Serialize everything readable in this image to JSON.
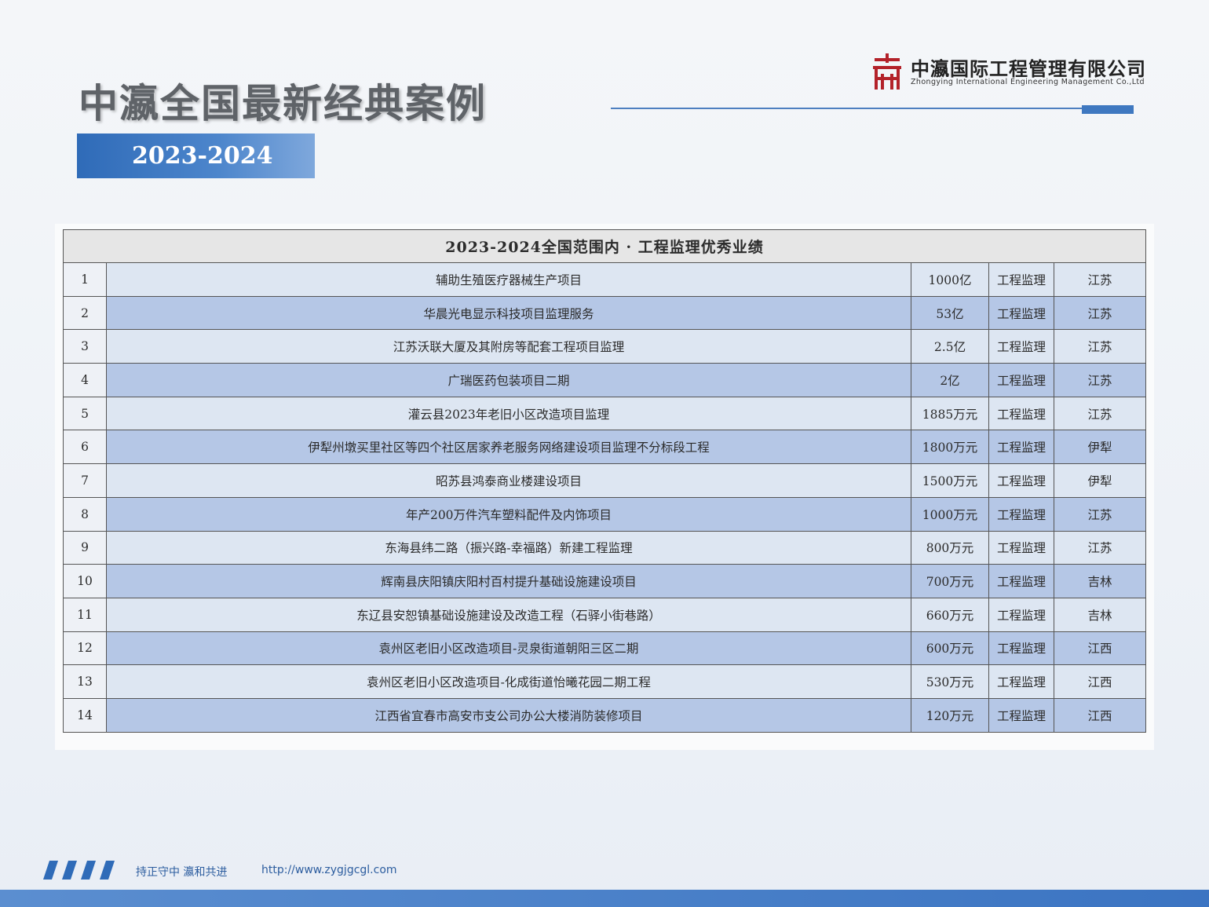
{
  "header": {
    "title": "中瀛全国最新经典案例",
    "year_badge": "2023-2024",
    "company_cn": "中瀛国际工程管理有限公司",
    "company_en": "Zhongying International Engineering Management Co.,Ltd"
  },
  "table": {
    "title": "2023-2024全国范围内 · 工程监理优秀业绩",
    "rows": [
      {
        "no": "1",
        "project": "辅助生殖医疗器械生产项目",
        "amount": "1000亿",
        "type": "工程监理",
        "region": "江苏"
      },
      {
        "no": "2",
        "project": "华晨光电显示科技项目监理服务",
        "amount": "53亿",
        "type": "工程监理",
        "region": "江苏"
      },
      {
        "no": "3",
        "project": "江苏沃联大厦及其附房等配套工程项目监理",
        "amount": "2.5亿",
        "type": "工程监理",
        "region": "江苏"
      },
      {
        "no": "4",
        "project": "广瑞医药包装项目二期",
        "amount": "2亿",
        "type": "工程监理",
        "region": "江苏"
      },
      {
        "no": "5",
        "project": "灌云县2023年老旧小区改造项目监理",
        "amount": "1885万元",
        "type": "工程监理",
        "region": "江苏"
      },
      {
        "no": "6",
        "project": "伊犁州墩买里社区等四个社区居家养老服务网络建设项目监理不分标段工程",
        "amount": "1800万元",
        "type": "工程监理",
        "region": "伊犁"
      },
      {
        "no": "7",
        "project": "昭苏县鸿泰商业楼建设项目",
        "amount": "1500万元",
        "type": "工程监理",
        "region": "伊犁"
      },
      {
        "no": "8",
        "project": "年产200万件汽车塑料配件及内饰项目",
        "amount": "1000万元",
        "type": "工程监理",
        "region": "江苏"
      },
      {
        "no": "9",
        "project": "东海县纬二路（振兴路-幸福路）新建工程监理",
        "amount": "800万元",
        "type": "工程监理",
        "region": "江苏"
      },
      {
        "no": "10",
        "project": "辉南县庆阳镇庆阳村百村提升基础设施建设项目",
        "amount": "700万元",
        "type": "工程监理",
        "region": "吉林"
      },
      {
        "no": "11",
        "project": "东辽县安恕镇基础设施建设及改造工程（石驿小街巷路）",
        "amount": "660万元",
        "type": "工程监理",
        "region": "吉林"
      },
      {
        "no": "12",
        "project": "袁州区老旧小区改造项目-灵泉街道朝阳三区二期",
        "amount": "600万元",
        "type": "工程监理",
        "region": "江西"
      },
      {
        "no": "13",
        "project": "袁州区老旧小区改造项目-化成街道怡曦花园二期工程",
        "amount": "530万元",
        "type": "工程监理",
        "region": "江西"
      },
      {
        "no": "14",
        "project": "江西省宜春市高安市支公司办公大楼消防装修项目",
        "amount": "120万元",
        "type": "工程监理",
        "region": "江西"
      }
    ]
  },
  "footer": {
    "slogan": "持正守中 瀛和共进",
    "url": "http://www.zygjgcgl.com"
  },
  "colors": {
    "accent": "#3b74c2",
    "row_dark": "#b5c7e6",
    "row_light": "#dde6f2",
    "logo_red": "#b3222a"
  }
}
